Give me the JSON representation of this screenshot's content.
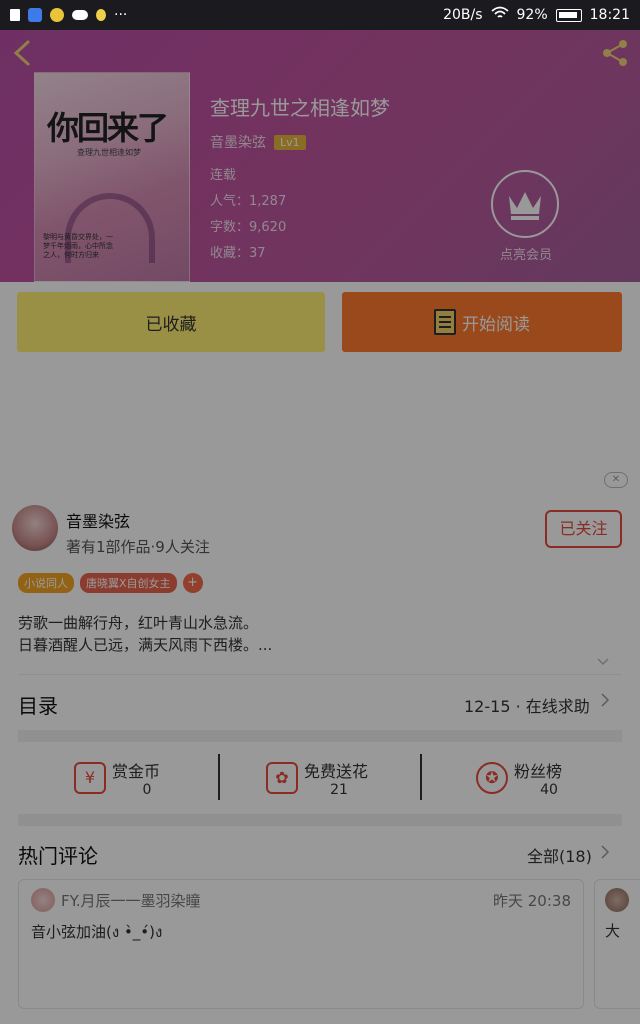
{
  "status_bar": {
    "speed": "20B/s",
    "battery": "92%",
    "time": "18:21"
  },
  "book": {
    "title": "查理九世之相逢如梦",
    "author": "音墨染弦",
    "level": "Lv1",
    "status": "连载",
    "popularity": "人气：1,287",
    "words": "字数：9,620",
    "favorites": "收藏：37",
    "cover_title": "你回来了",
    "cover_subtitle": "查理九世相逢如梦",
    "cover_blurb": "黎明与黄昏交界处，一梦千年烟雨，心中所念之人，何时方归来"
  },
  "vip": {
    "label": "点亮会员"
  },
  "actions": {
    "collected_label": "已收藏",
    "read_label": "开始阅读"
  },
  "ad_close": "✕",
  "author_card": {
    "name": "音墨染弦",
    "stats": "著有1部作品·9人关注",
    "follow_label": "已关注",
    "tags": [
      "小说同人",
      "唐晓翼X自创女主"
    ],
    "tag_plus": "+",
    "bio_line1": "劳歌一曲解行舟，红叶青山水急流。",
    "bio_line2": "日暮酒醒人已远，满天风雨下西楼。..."
  },
  "toc": {
    "title": "目录",
    "latest": "12-15 · 在线求助"
  },
  "stats": [
    {
      "label": "赏金币",
      "value": "0",
      "icon": "coin-icon"
    },
    {
      "label": "免费送花",
      "value": "21",
      "icon": "flower-icon"
    },
    {
      "label": "粉丝榜",
      "value": "40",
      "icon": "medal-icon"
    }
  ],
  "comments": {
    "title": "热门评论",
    "all_label": "全部(18)",
    "items": [
      {
        "user": "FY.月辰一一墨羽染瞳",
        "time": "昨天 20:38",
        "text": "音小弦加油(ง •̀_•́)ง"
      },
      {
        "text": "大"
      }
    ]
  }
}
